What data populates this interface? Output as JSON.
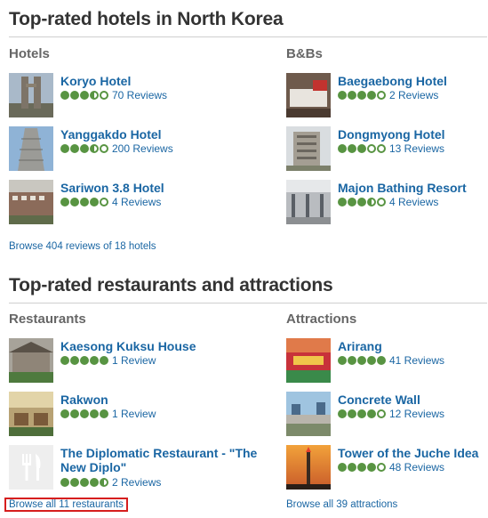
{
  "hotels_section": {
    "title": "Top-rated hotels in North Korea",
    "hotels": {
      "heading": "Hotels",
      "items": [
        {
          "name": "Koryo Hotel",
          "reviews": "70 Reviews",
          "rating": 3.5
        },
        {
          "name": "Yanggakdo Hotel",
          "reviews": "200 Reviews",
          "rating": 3.5
        },
        {
          "name": "Sariwon 3.8 Hotel",
          "reviews": "4 Reviews",
          "rating": 4
        }
      ],
      "browse": "Browse 404 reviews of 18 hotels"
    },
    "bnbs": {
      "heading": "B&Bs",
      "items": [
        {
          "name": "Baegaebong Hotel",
          "reviews": "2 Reviews",
          "rating": 4
        },
        {
          "name": "Dongmyong Hotel",
          "reviews": "13 Reviews",
          "rating": 3
        },
        {
          "name": "Majon Bathing Resort",
          "reviews": "4 Reviews",
          "rating": 3.5
        }
      ]
    }
  },
  "eat_section": {
    "title": "Top-rated restaurants and attractions",
    "restaurants": {
      "heading": "Restaurants",
      "items": [
        {
          "name": "Kaesong Kuksu House",
          "reviews": "1 Review",
          "rating": 5
        },
        {
          "name": "Rakwon",
          "reviews": "1 Review",
          "rating": 5
        },
        {
          "name": "The Diplomatic Restaurant - \"The New Diplo\"",
          "reviews": "2 Reviews",
          "rating": 4.5
        }
      ],
      "browse": "Browse all 11 restaurants"
    },
    "attractions": {
      "heading": "Attractions",
      "items": [
        {
          "name": "Arirang",
          "reviews": "41 Reviews",
          "rating": 5
        },
        {
          "name": "Concrete Wall",
          "reviews": "12 Reviews",
          "rating": 4
        },
        {
          "name": "Tower of the Juche Idea",
          "reviews": "48 Reviews",
          "rating": 4
        }
      ],
      "browse": "Browse all 39 attractions"
    }
  },
  "colors": {
    "link": "#1a66a3",
    "bubble": "#589442",
    "highlight": "#d61e1e"
  }
}
